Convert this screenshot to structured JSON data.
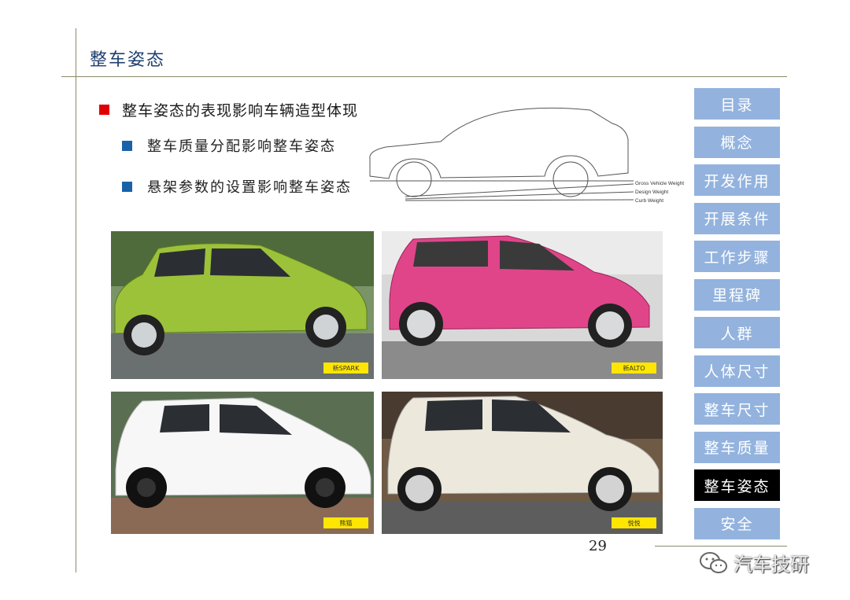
{
  "slide": {
    "title": "整车姿态",
    "main_bullet": "整车姿态的表现影响车辆造型体现",
    "sub_bullets": [
      "整车质量分配影响整车姿态",
      "悬架参数的设置影响整车姿态"
    ],
    "page_number": "29"
  },
  "diagram": {
    "labels": [
      "Gross Vehicle Weight",
      "Design Weight",
      "Curb Weight"
    ]
  },
  "photos": [
    {
      "tag": "新SPARK",
      "body_color": "#9cc23a"
    },
    {
      "tag": "新ALTO",
      "body_color": "#e0458a"
    },
    {
      "tag": "熊猫",
      "body_color": "#f7f7f7"
    },
    {
      "tag": "悦悦",
      "body_color": "#ece8dc"
    }
  ],
  "nav": {
    "items": [
      "目录",
      "概念",
      "开发作用",
      "开展条件",
      "工作步骤",
      "里程碑",
      "人群",
      "人体尺寸",
      "整车尺寸",
      "整车质量",
      "整车姿态",
      "安全"
    ],
    "active": "整车姿态",
    "item_color": "#93b3de",
    "active_color": "#000000"
  },
  "watermark": {
    "text": "汽车技研",
    "icon": "wechat-icon"
  }
}
